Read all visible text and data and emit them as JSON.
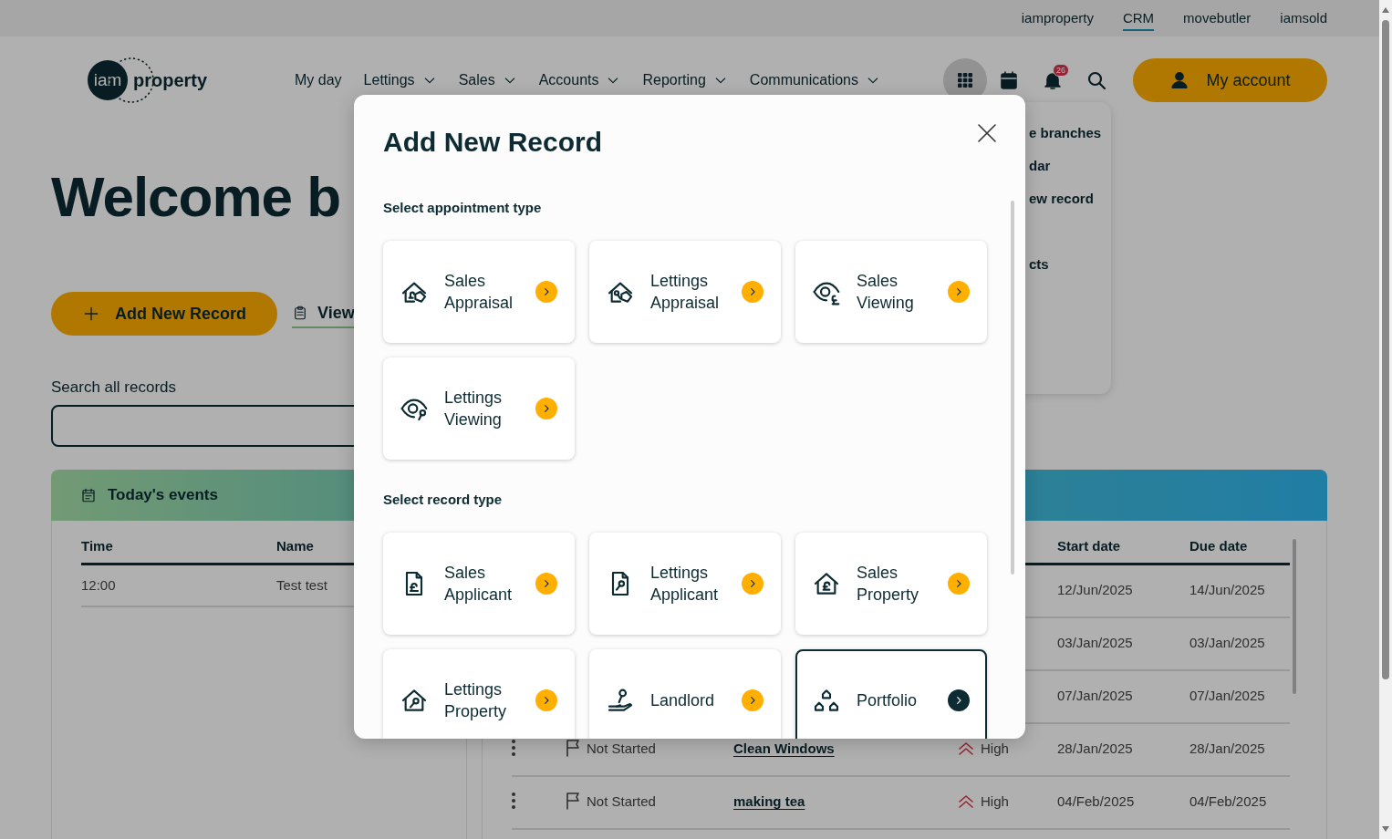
{
  "top_links": [
    {
      "label": "iamproperty",
      "selected": false
    },
    {
      "label": "CRM",
      "selected": true
    },
    {
      "label": "movebutler",
      "selected": false
    },
    {
      "label": "iamsold",
      "selected": false
    }
  ],
  "logo": {
    "badge": "iam",
    "text": "property"
  },
  "nav": [
    {
      "label": "My day",
      "dropdown": false
    },
    {
      "label": "Lettings",
      "dropdown": true
    },
    {
      "label": "Sales",
      "dropdown": true
    },
    {
      "label": "Accounts",
      "dropdown": true
    },
    {
      "label": "Reporting",
      "dropdown": true
    },
    {
      "label": "Communications",
      "dropdown": true
    }
  ],
  "tools": [
    {
      "kind": "apps",
      "selected": true
    },
    {
      "kind": "calendar",
      "selected": false
    },
    {
      "kind": "notifications",
      "selected": false,
      "badge": "26"
    },
    {
      "kind": "search",
      "selected": false
    }
  ],
  "account_button": "My account",
  "apps_menu": {
    "items": [
      "e branches",
      "dar",
      "ew record",
      "cts"
    ]
  },
  "welcome": "Welcome b",
  "actions": {
    "add_button": "Add New Record",
    "view_link": "View"
  },
  "search": {
    "label": "Search all records"
  },
  "events": {
    "title": "Today's events",
    "columns": [
      "Time",
      "Name"
    ],
    "rows": [
      [
        "12:00",
        "Test test"
      ]
    ]
  },
  "tasks": {
    "columns": {
      "start": "Start date",
      "due": "Due date"
    },
    "rows": [
      {
        "start": "12/Jun/2025",
        "due": "14/Jun/2025"
      },
      {
        "start": "03/Jan/2025",
        "due": "03/Jan/2025"
      },
      {
        "start": "07/Jan/2025",
        "due": "07/Jan/2025"
      },
      {
        "status": "Not Started",
        "name": "Clean Windows",
        "priority": "High",
        "start": "28/Jan/2025",
        "due": "28/Jan/2025"
      },
      {
        "status": "Not Started",
        "name": "making tea",
        "priority": "High",
        "start": "04/Feb/2025",
        "due": "04/Feb/2025"
      }
    ]
  },
  "modal": {
    "title": "Add New Record",
    "sections": [
      {
        "title": "Select appointment type",
        "cards": [
          {
            "label": "Sales Appraisal",
            "selected": false
          },
          {
            "label": "Lettings Appraisal",
            "selected": false
          },
          {
            "label": "Sales Viewing",
            "selected": false
          },
          {
            "label": "Lettings Viewing",
            "selected": false
          }
        ]
      },
      {
        "title": "Select record type",
        "cards": [
          {
            "label": "Sales Applicant",
            "selected": false
          },
          {
            "label": "Lettings Applicant",
            "selected": false
          },
          {
            "label": "Sales Property",
            "selected": false
          },
          {
            "label": "Lettings Property",
            "selected": false
          },
          {
            "label": "Landlord",
            "selected": false
          },
          {
            "label": "Portfolio",
            "selected": true
          }
        ]
      }
    ]
  }
}
